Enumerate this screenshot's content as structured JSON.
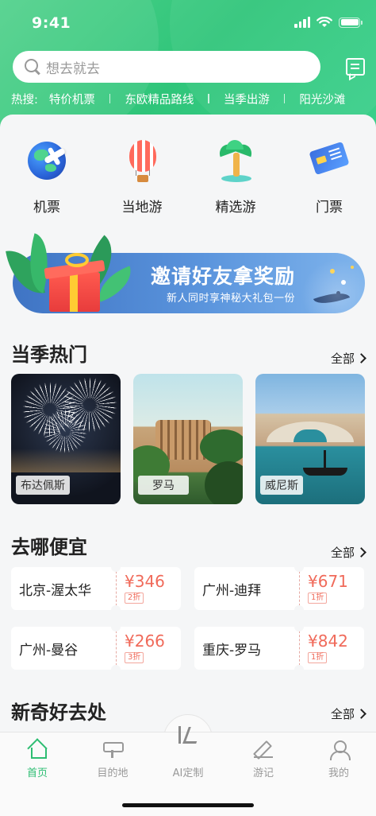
{
  "status_bar": {
    "time": "9:41"
  },
  "search": {
    "placeholder": "想去就去"
  },
  "hot_searches": {
    "label": "热搜:",
    "items": [
      "特价机票",
      "东欧精品路线",
      "当季出游",
      "阳光沙滩"
    ]
  },
  "categories": [
    {
      "label": "机票",
      "icon": "globe-plane-icon"
    },
    {
      "label": "当地游",
      "icon": "hot-air-balloon-icon"
    },
    {
      "label": "精选游",
      "icon": "palm-tree-icon"
    },
    {
      "label": "门票",
      "icon": "ticket-icon"
    }
  ],
  "banner": {
    "title": "邀请好友拿奖励",
    "subtitle": "新人同时享神秘大礼包一份"
  },
  "seasonal": {
    "title": "当季热门",
    "see_all": "全部",
    "destinations": [
      {
        "name": "布达佩斯"
      },
      {
        "name": "罗马"
      },
      {
        "name": "威尼斯"
      }
    ]
  },
  "cheap": {
    "title": "去哪便宜",
    "see_all": "全部",
    "deals": [
      {
        "route": "北京-渥太华",
        "price": "¥346",
        "discount": "2折"
      },
      {
        "route": "广州-迪拜",
        "price": "¥671",
        "discount": "1折"
      },
      {
        "route": "广州-曼谷",
        "price": "¥266",
        "discount": "3折"
      },
      {
        "route": "重庆-罗马",
        "price": "¥842",
        "discount": "1折"
      }
    ]
  },
  "novel": {
    "title": "新奇好去处",
    "see_all": "全部"
  },
  "bottom_nav": {
    "items": [
      {
        "label": "首页",
        "icon": "home-icon",
        "active": true
      },
      {
        "label": "目的地",
        "icon": "signpost-icon",
        "active": false
      },
      {
        "label": "AI定制",
        "icon": "ai-icon",
        "active": false
      },
      {
        "label": "游记",
        "icon": "pen-icon",
        "active": false
      },
      {
        "label": "我的",
        "icon": "user-icon",
        "active": false
      }
    ]
  },
  "colors": {
    "brand_green": "#2dbd72",
    "price_red": "#f06a5a",
    "banner_blue": "#4a84d0"
  }
}
